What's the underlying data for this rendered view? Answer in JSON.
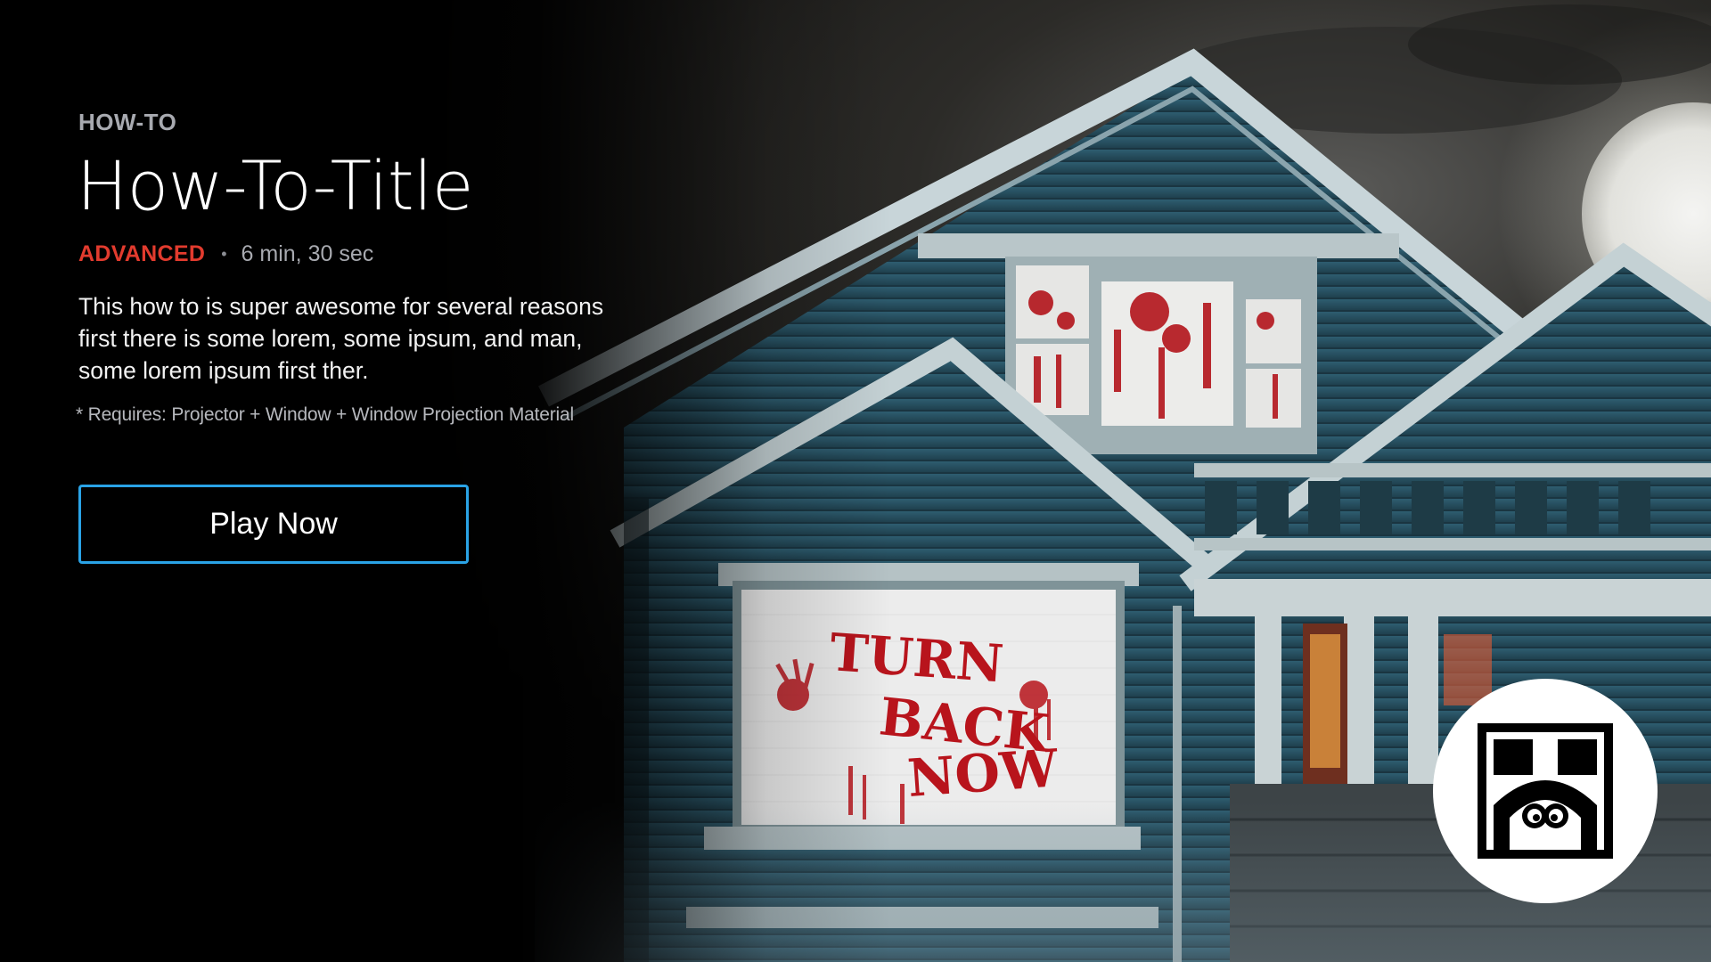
{
  "category": "HOW-TO",
  "title": "How-To-Title",
  "difficulty": "ADVANCED",
  "separator": "•",
  "duration": "6 min, 30 sec",
  "description": "This how to is super awesome for several reasons first there is some lorem, some ipsum, and man, some lorem ipsum first ther.",
  "requirements": "* Requires:  Projector + Window + Window Projection Material",
  "play_button_label": "Play Now",
  "hero_window_text": [
    "TURN",
    "BACK",
    "NOW"
  ],
  "colors": {
    "difficulty": "#e23b2e",
    "button_border": "#2aa3e6",
    "house_siding": "#2c5566"
  },
  "icons": {
    "logo": "window-monster-logo-icon"
  }
}
